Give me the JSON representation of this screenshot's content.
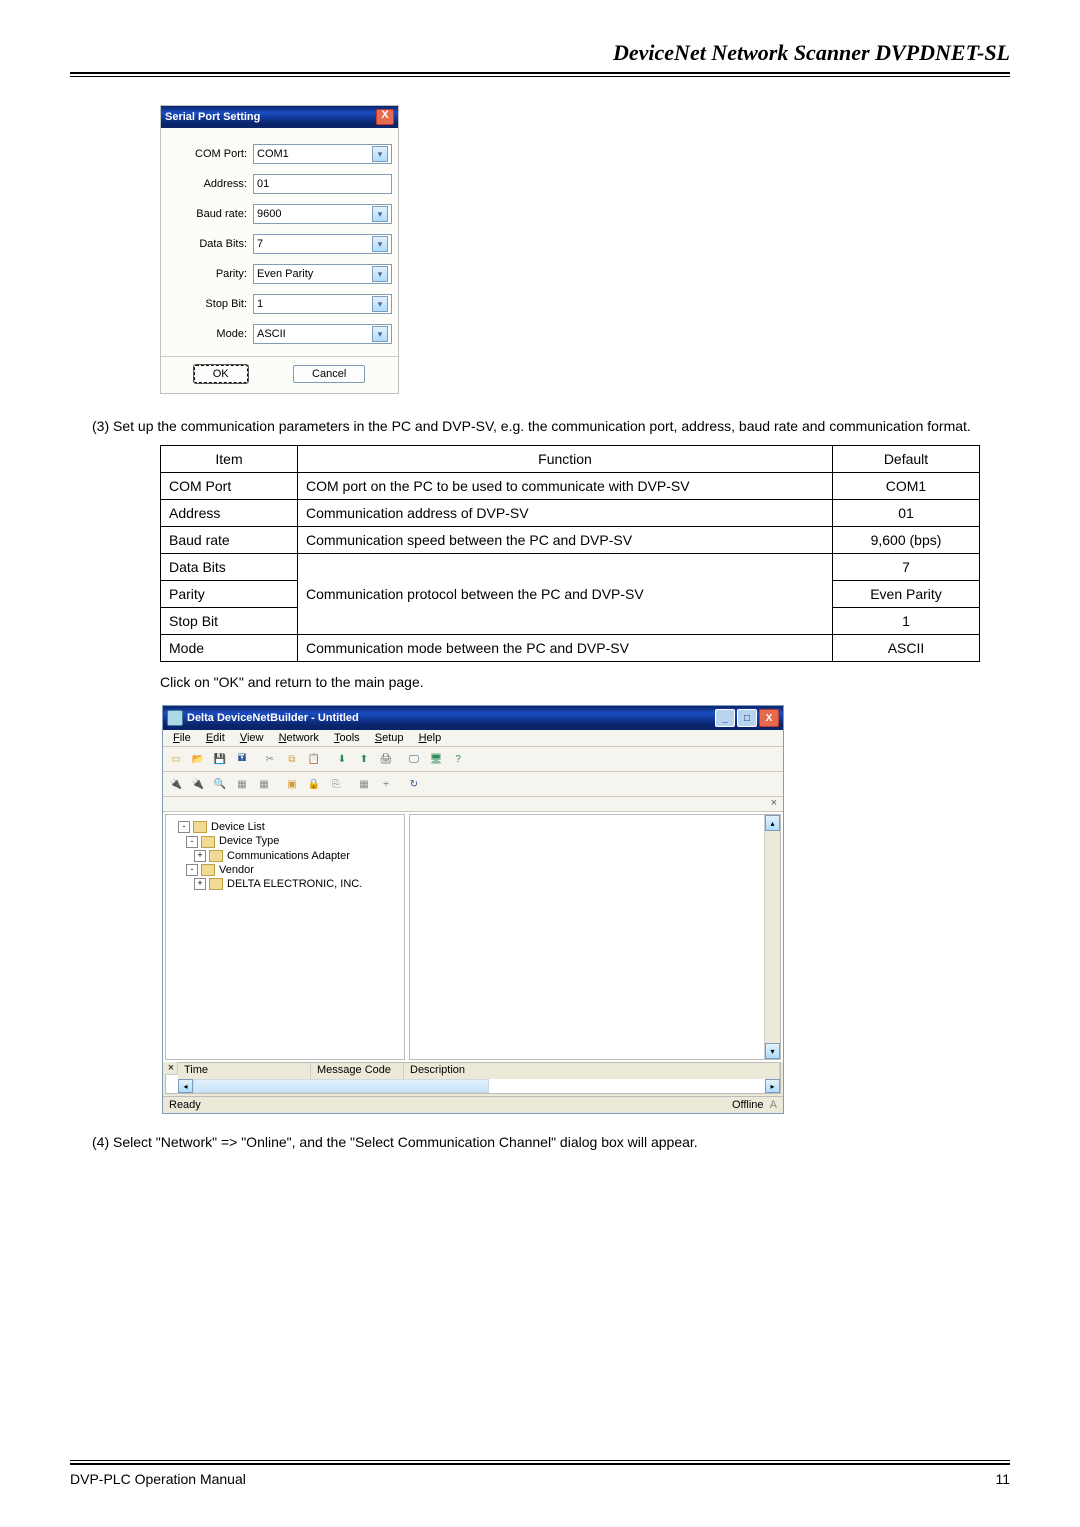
{
  "header": {
    "title": "DeviceNet Network Scanner DVPDNET-SL"
  },
  "serial_dialog": {
    "title": "Serial Port Setting",
    "fields": {
      "com_port": {
        "label": "COM Port:",
        "value": "COM1",
        "dropdown": true
      },
      "address": {
        "label": "Address:",
        "value": "01",
        "dropdown": false
      },
      "baud_rate": {
        "label": "Baud rate:",
        "value": "9600",
        "dropdown": true
      },
      "data_bits": {
        "label": "Data Bits:",
        "value": "7",
        "dropdown": true
      },
      "parity": {
        "label": "Parity:",
        "value": "Even Parity",
        "dropdown": true
      },
      "stop_bit": {
        "label": "Stop Bit:",
        "value": "1",
        "dropdown": true
      },
      "mode": {
        "label": "Mode:",
        "value": "ASCII",
        "dropdown": true
      }
    },
    "ok_label": "OK",
    "cancel_label": "Cancel"
  },
  "paragraph_3": "(3) Set up the communication parameters in the PC and DVP-SV, e.g. the communication port, address, baud rate and communication format.",
  "param_table": {
    "headers": {
      "item": "Item",
      "func": "Function",
      "def": "Default"
    },
    "rows": [
      {
        "item": "COM Port",
        "func": "COM port on the PC to be used to communicate with DVP-SV",
        "def": "COM1"
      },
      {
        "item": "Address",
        "func": "Communication address of DVP-SV",
        "def": "01"
      },
      {
        "item": "Baud rate",
        "func": "Communication speed between the PC and DVP-SV",
        "def": "9,600 (bps)"
      },
      {
        "item": "Data Bits",
        "func": "",
        "def": "7"
      },
      {
        "item": "Parity",
        "func": "Communication protocol between the PC and DVP-SV",
        "def": "Even Parity"
      },
      {
        "item": "Stop Bit",
        "func": "",
        "def": "1"
      },
      {
        "item": "Mode",
        "func": "Communication mode between the PC and DVP-SV",
        "def": "ASCII"
      }
    ]
  },
  "click_ok_line": "Click on \"OK\" and return to the main page.",
  "app_window": {
    "title": "Delta DeviceNetBuilder - Untitled",
    "menus": [
      "File",
      "Edit",
      "View",
      "Network",
      "Tools",
      "Setup",
      "Help"
    ],
    "tree": {
      "root": "Device List",
      "device_type": "Device Type",
      "comm_adapter": "Communications Adapter",
      "vendor": "Vendor",
      "delta": "DELTA ELECTRONIC, INC."
    },
    "msg_cols": {
      "time": "Time",
      "code": "Message Code",
      "desc": "Description"
    },
    "status_left": "Ready",
    "status_right": "Offline"
  },
  "paragraph_4": "(4) Select \"Network\" => \"Online\", and the \"Select Communication Channel\" dialog box will appear.",
  "footer": {
    "left": "DVP-PLC Operation Manual",
    "right": "11"
  }
}
